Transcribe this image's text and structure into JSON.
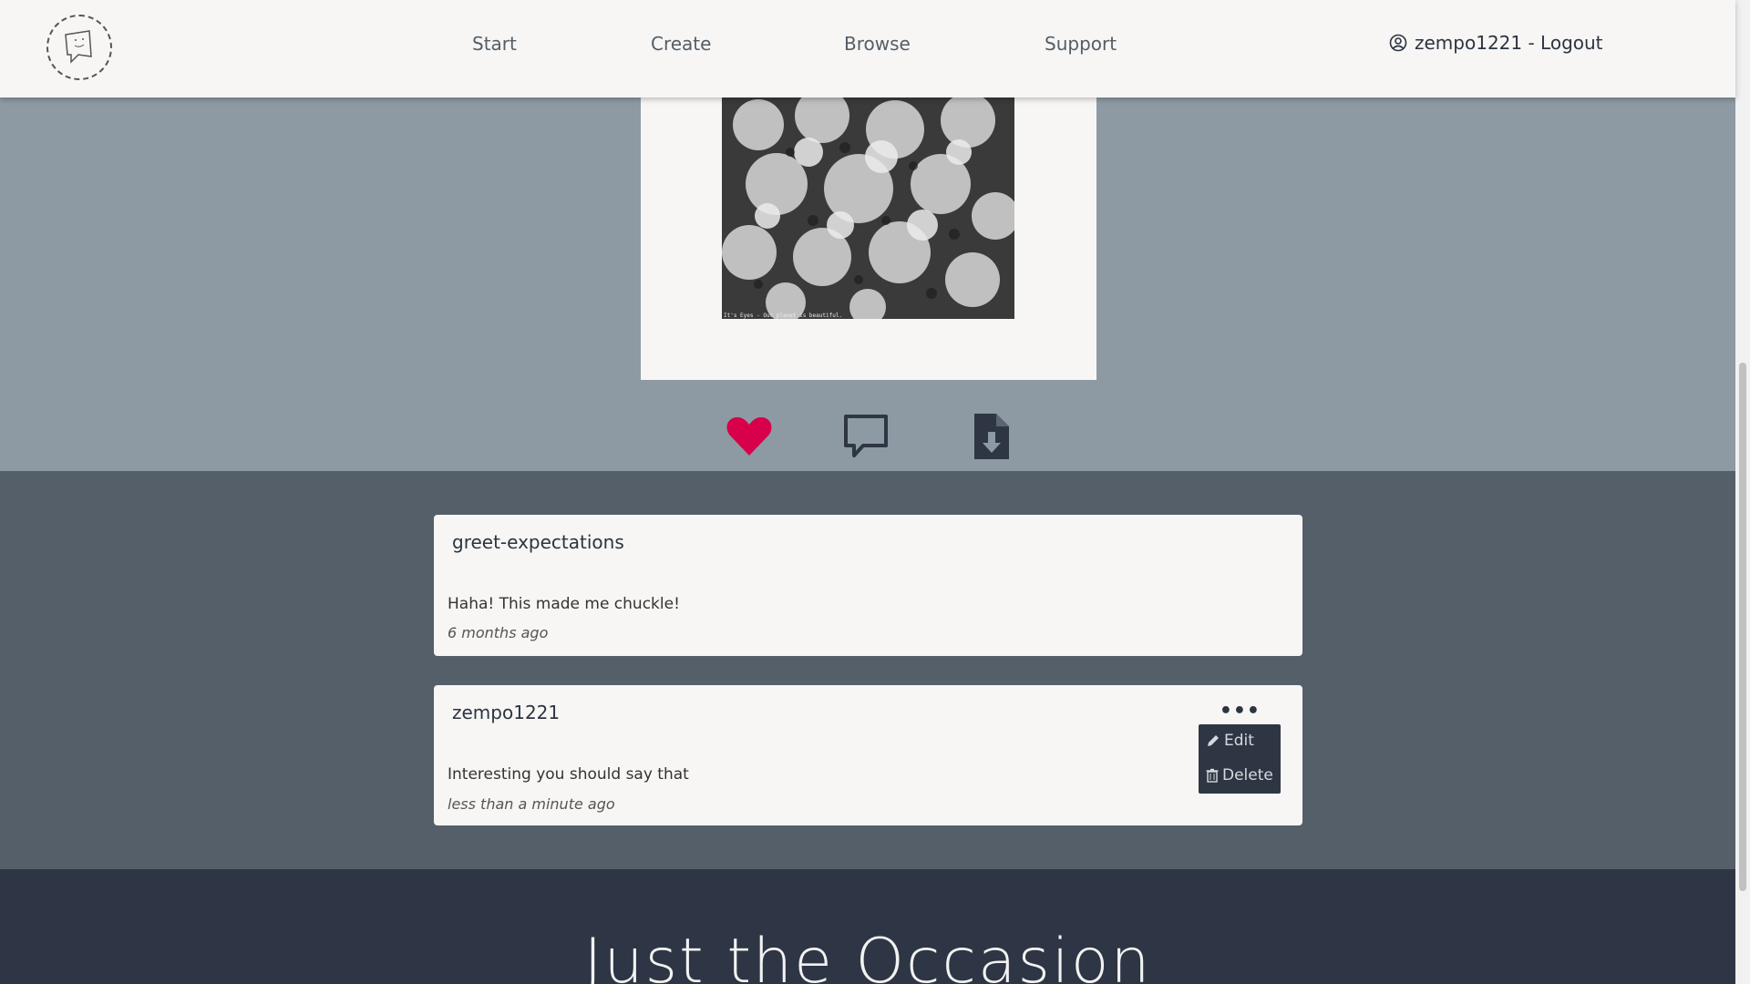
{
  "nav": {
    "links": [
      "Start",
      "Create",
      "Browse",
      "Support"
    ],
    "user_label": "zempo1221 - Logout"
  },
  "photo": {
    "caption": "It's Eyes - Our planet is beautiful."
  },
  "actions": {
    "like_icon": "heart-icon",
    "comment_icon": "comment-icon",
    "download_icon": "download-file-icon",
    "like_color": "#d8004b"
  },
  "comments": [
    {
      "author": "greet-expectations",
      "text": "Haha! This made me chuckle!",
      "time": "6 months ago"
    },
    {
      "author": "zempo1221",
      "text": "Interesting you should say that",
      "time": "less than a minute ago",
      "more": "•••",
      "menu": {
        "edit": "Edit",
        "delete": "Delete"
      }
    }
  ],
  "footer": {
    "title": "Just the Occasion"
  }
}
